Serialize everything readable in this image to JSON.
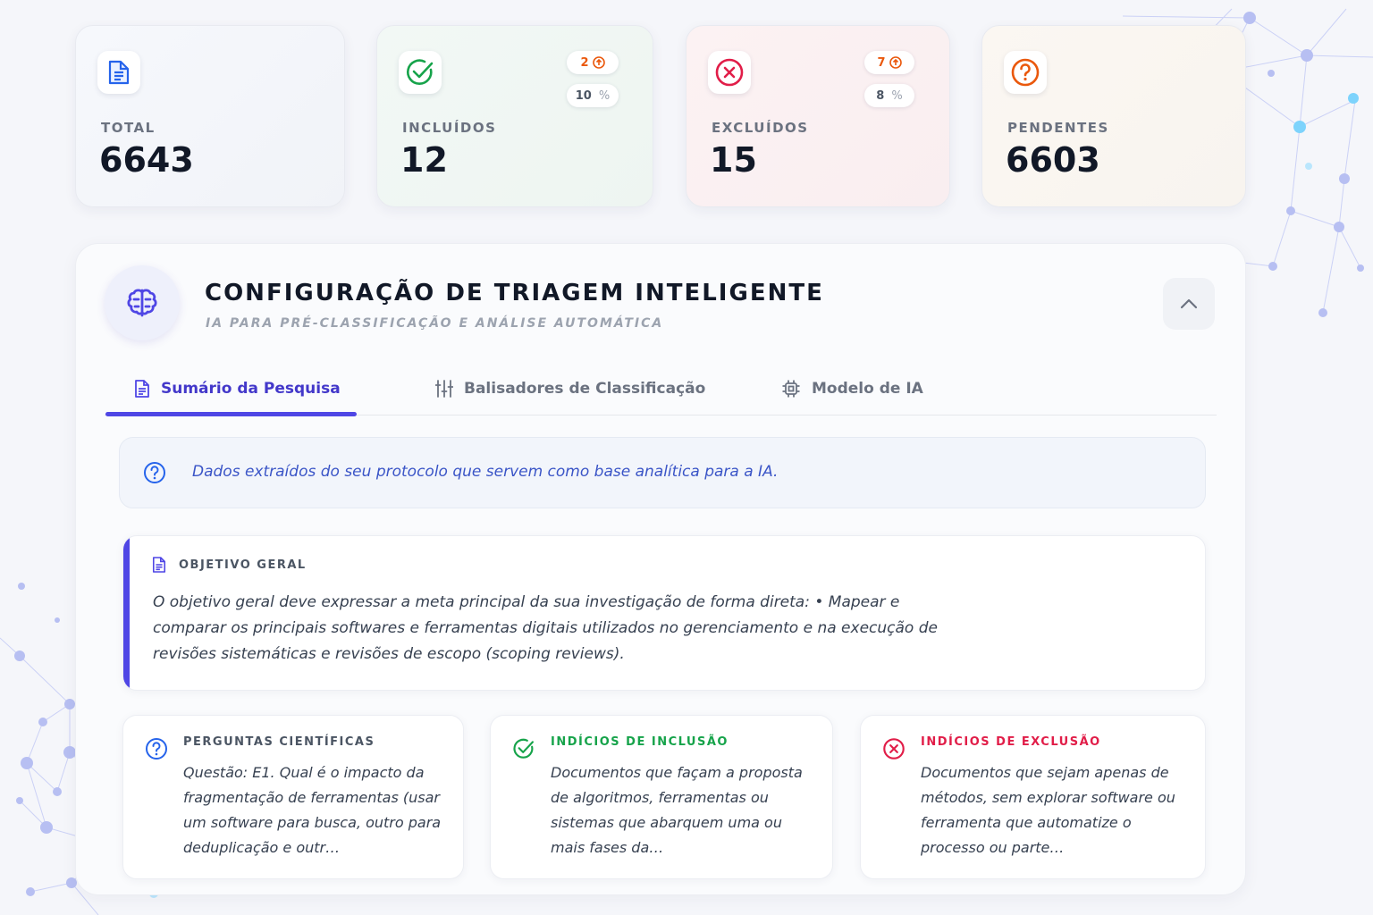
{
  "stats": [
    {
      "label": "TOTAL",
      "value": "6643",
      "icon": "document-icon"
    },
    {
      "label": "INCLUÍDOS",
      "value": "12",
      "icon": "check-circle-icon",
      "badge_count": "2",
      "badge_percent": "10"
    },
    {
      "label": "EXCLUÍDOS",
      "value": "15",
      "icon": "x-circle-icon",
      "badge_count": "7",
      "badge_percent": "8"
    },
    {
      "label": "PENDENTES",
      "value": "6603",
      "icon": "question-circle-icon"
    }
  ],
  "percent_sign": "%",
  "panel": {
    "title": "CONFIGURAÇÃO DE TRIAGEM INTELIGENTE",
    "subtitle": "IA PARA PRÉ-CLASSIFICAÇÃO E ANÁLISE AUTOMÁTICA",
    "tabs": [
      {
        "label": "Sumário da Pesquisa",
        "active": true
      },
      {
        "label": "Balisadores de Classificação",
        "active": false
      },
      {
        "label": "Modelo de IA",
        "active": false
      }
    ],
    "info": "Dados extraídos do seu protocolo que servem como base analítica para a IA.",
    "objective": {
      "title": "OBJETIVO GERAL",
      "text": "O objetivo geral deve expressar a meta principal da sua investigação de forma direta: • Mapear e comparar os principais softwares e ferramentas digitais utilizados no gerenciamento e na execução de revisões sistemáticas e revisões de escopo (scoping reviews)."
    },
    "cards": [
      {
        "title": "PERGUNTAS CIENTÍFICAS",
        "text": "Questão: E1. Qual é o impacto da fragmentação de ferramentas (usar um software para busca, outro para deduplicação e outr…"
      },
      {
        "title": "INDÍCIOS DE INCLUSÃO",
        "text": "Documentos que façam a proposta de algoritmos, ferramentas ou sistemas que abarquem uma ou mais fases da…"
      },
      {
        "title": "INDÍCIOS DE EXCLUSÃO",
        "text": "Documentos que sejam apenas de métodos, sem explorar software ou ferramenta que automatize o processo ou parte…"
      }
    ]
  },
  "colors": {
    "accent": "#4f46e5",
    "included": "#16a34a",
    "excluded": "#e11d48",
    "pending": "#ea580c",
    "info": "#3b55c7"
  }
}
